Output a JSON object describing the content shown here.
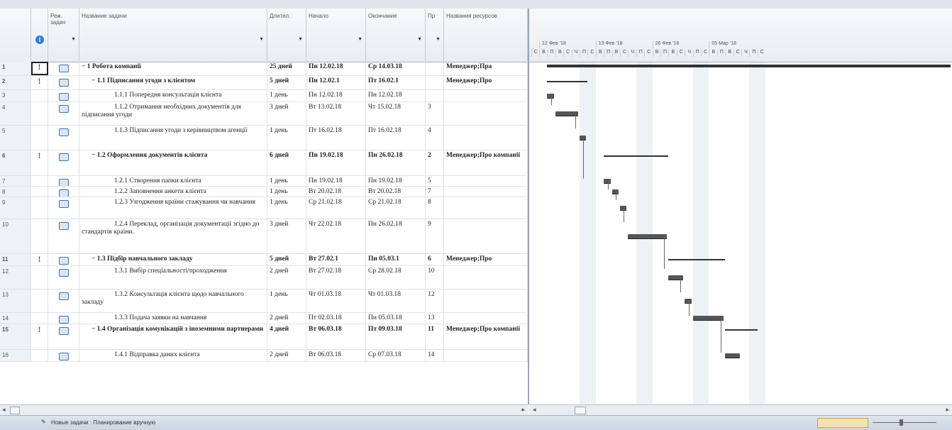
{
  "columns": {
    "mode": "Реж. задач",
    "name": "Название задачи",
    "duration": "Длител.",
    "start": "Начало",
    "finish": "Окончание",
    "pred": "Пр",
    "resources": "Названия ресурсов"
  },
  "rows": [
    {
      "id": "1",
      "ind": "!",
      "name": "1 Робота компанії",
      "duration": "25 дней",
      "start": "Пн 12.02.18",
      "finish": "Ср 14.03.18",
      "pred": "",
      "res": "Менеджер;Пра",
      "summary": true,
      "level": 0,
      "h": 19
    },
    {
      "id": "2",
      "ind": "!",
      "name": "1.1 Підписання угоди з клієнтом",
      "duration": "5 дней",
      "start": "Пн 12.02.1",
      "finish": "Пт 16.02.1",
      "pred": "",
      "res": "Менеджер;Про",
      "summary": true,
      "level": 1,
      "h": 19
    },
    {
      "id": "3",
      "ind": "",
      "name": "1.1.1 Попередня консультація клієнта",
      "duration": "1 день",
      "start": "Пн 12.02.18",
      "finish": "Пн 12.02.18",
      "pred": "",
      "res": "",
      "summary": false,
      "level": 2,
      "h": 16
    },
    {
      "id": "4",
      "ind": "",
      "name": "1.1.2 Отримання необхідних документів для підписання угоди",
      "duration": "3 дней",
      "start": "Вт 13.02.18",
      "finish": "Чт 15.02.18",
      "pred": "3",
      "res": "",
      "summary": false,
      "level": 2,
      "h": 32
    },
    {
      "id": "5",
      "ind": "",
      "name": "1.1.3 Підписання угоди з керівництвом агенції",
      "duration": "1 день",
      "start": "Пт 16.02.18",
      "finish": "Пт 16.02.18",
      "pred": "4",
      "res": "",
      "summary": false,
      "level": 2,
      "h": 34
    },
    {
      "id": "6",
      "ind": "!",
      "name": "1.2 Оформлення документів клієнта",
      "duration": "6 дней",
      "start": "Пн 19.02.18",
      "finish": "Пн 26.02.18",
      "pred": "2",
      "res": "Менеджер;Про компанії",
      "summary": true,
      "level": 1,
      "h": 35
    },
    {
      "id": "7",
      "ind": "",
      "name": "1.2.1 Створення папки клієнта",
      "duration": "1 день",
      "start": "Пн 19.02.18",
      "finish": "Пн 19.02.18",
      "pred": "5",
      "res": "",
      "summary": false,
      "level": 2,
      "h": 14
    },
    {
      "id": "8",
      "ind": "",
      "name": "1.2.2 Заповнення анкети клієнта",
      "duration": "1 день",
      "start": "Вт 20.02.18",
      "finish": "Вт 20.02.18",
      "pred": "7",
      "res": "",
      "summary": false,
      "level": 2,
      "h": 14
    },
    {
      "id": "9",
      "ind": "",
      "name": "1.2.3 Узгодження країни стажування чи навчання",
      "duration": "1 день",
      "start": "Ср 21.02.18",
      "finish": "Ср 21.02.18",
      "pred": "8",
      "res": "",
      "summary": false,
      "level": 2,
      "h": 30
    },
    {
      "id": "10",
      "ind": "",
      "name": "1.2.4 Переклад, організація документації згідно до стандартів країни.",
      "duration": "3 дней",
      "start": "Чт 22.02.18",
      "finish": "Пн 26.02.18",
      "pred": "9",
      "res": "",
      "summary": false,
      "level": 2,
      "h": 48
    },
    {
      "id": "11",
      "ind": "!",
      "name": "1.3 Підбір навчального закладу",
      "duration": "5 дней",
      "start": "Вт 27.02.1",
      "finish": "Пн 05.03.1",
      "pred": "6",
      "res": "Менеджер;Про",
      "summary": true,
      "level": 1,
      "h": 16
    },
    {
      "id": "12",
      "ind": "",
      "name": "1.3.1 Вибір спеціальності/проходження",
      "duration": "2 дней",
      "start": "Вт 27.02.18",
      "finish": "Ср 28.02.18",
      "pred": "10",
      "res": "",
      "summary": false,
      "level": 2,
      "h": 32
    },
    {
      "id": "13",
      "ind": "",
      "name": "1.3.2 Консультація клієнта щодо навчального закладу",
      "duration": "1 день",
      "start": "Чт 01.03.18",
      "finish": "Чт 01.03.18",
      "pred": "12",
      "res": "",
      "summary": false,
      "level": 2,
      "h": 32
    },
    {
      "id": "14",
      "ind": "",
      "name": "1.3.3 Подача заявки на навчання",
      "duration": "2 дней",
      "start": "Пт 02.03.18",
      "finish": "Пн 05.03.18",
      "pred": "13",
      "res": "",
      "summary": false,
      "level": 2,
      "h": 15
    },
    {
      "id": "15",
      "ind": "!",
      "name": "1.4 Організація комунікацій з іноземними партнерами",
      "duration": "4 дней",
      "start": "Вт 06.03.18",
      "finish": "Пт 09.03.18",
      "pred": "11",
      "res": "Менеджер;Про компанії",
      "summary": true,
      "level": 1,
      "h": 35
    },
    {
      "id": "16",
      "ind": "",
      "name": "1.4.1 Відправка даних клієнта",
      "duration": "2 дней",
      "start": "Вт 06.03.18",
      "finish": "Ср 07.03.18",
      "pred": "14",
      "res": "",
      "summary": false,
      "level": 2,
      "h": 16
    }
  ],
  "timescale": {
    "weeks": [
      "12 Фев '18",
      "19 Фев '18",
      "26 Фев '18",
      "05 Мар '18"
    ],
    "days": [
      "В",
      "П",
      "В",
      "С",
      "Ч",
      "П",
      "С"
    ]
  },
  "gantt_tasks": [
    {
      "row": 0,
      "start": "2018-02-12",
      "end": "2018-03-14",
      "summary": true
    },
    {
      "row": 1,
      "start": "2018-02-12",
      "end": "2018-02-16",
      "summary": true
    },
    {
      "row": 2,
      "start": "2018-02-12",
      "end": "2018-02-12",
      "summary": false
    },
    {
      "row": 3,
      "start": "2018-02-13",
      "end": "2018-02-15",
      "summary": false
    },
    {
      "row": 4,
      "start": "2018-02-16",
      "end": "2018-02-16",
      "summary": false
    },
    {
      "row": 5,
      "start": "2018-02-19",
      "end": "2018-02-26",
      "summary": true
    },
    {
      "row": 6,
      "start": "2018-02-19",
      "end": "2018-02-19",
      "summary": false
    },
    {
      "row": 7,
      "start": "2018-02-20",
      "end": "2018-02-20",
      "summary": false
    },
    {
      "row": 8,
      "start": "2018-02-21",
      "end": "2018-02-21",
      "summary": false
    },
    {
      "row": 9,
      "start": "2018-02-22",
      "end": "2018-02-26",
      "summary": false
    },
    {
      "row": 10,
      "start": "2018-02-27",
      "end": "2018-03-05",
      "summary": true
    },
    {
      "row": 11,
      "start": "2018-02-27",
      "end": "2018-02-28",
      "summary": false
    },
    {
      "row": 12,
      "start": "2018-03-01",
      "end": "2018-03-01",
      "summary": false
    },
    {
      "row": 13,
      "start": "2018-03-02",
      "end": "2018-03-05",
      "summary": false
    },
    {
      "row": 14,
      "start": "2018-03-06",
      "end": "2018-03-09",
      "summary": true
    },
    {
      "row": 15,
      "start": "2018-03-06",
      "end": "2018-03-07",
      "summary": false
    }
  ],
  "status": {
    "mode": "Новые задачи : Планирование вручную"
  }
}
